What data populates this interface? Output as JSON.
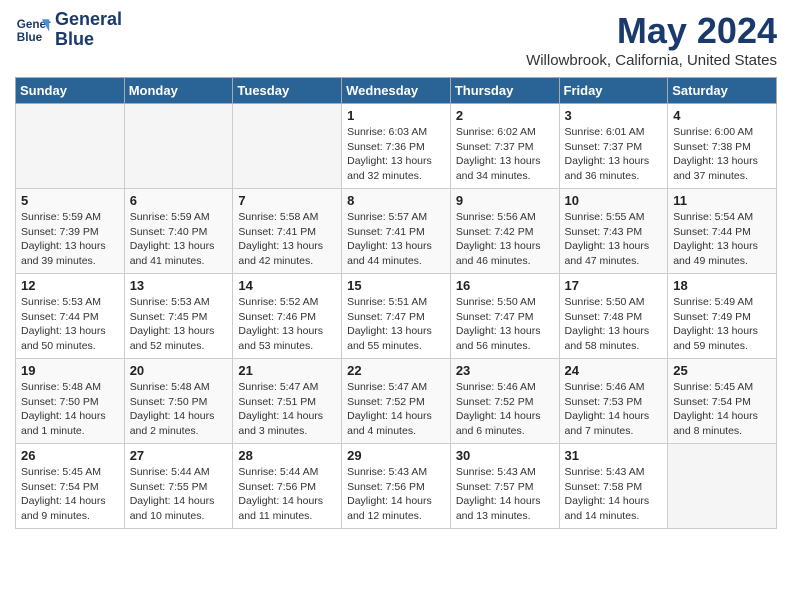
{
  "header": {
    "logo_line1": "General",
    "logo_line2": "Blue",
    "month_title": "May 2024",
    "location": "Willowbrook, California, United States"
  },
  "days_of_week": [
    "Sunday",
    "Monday",
    "Tuesday",
    "Wednesday",
    "Thursday",
    "Friday",
    "Saturday"
  ],
  "weeks": [
    [
      {
        "num": "",
        "empty": true
      },
      {
        "num": "",
        "empty": true
      },
      {
        "num": "",
        "empty": true
      },
      {
        "num": "1",
        "sunrise": "6:03 AM",
        "sunset": "7:36 PM",
        "daylight": "13 hours and 32 minutes."
      },
      {
        "num": "2",
        "sunrise": "6:02 AM",
        "sunset": "7:37 PM",
        "daylight": "13 hours and 34 minutes."
      },
      {
        "num": "3",
        "sunrise": "6:01 AM",
        "sunset": "7:37 PM",
        "daylight": "13 hours and 36 minutes."
      },
      {
        "num": "4",
        "sunrise": "6:00 AM",
        "sunset": "7:38 PM",
        "daylight": "13 hours and 37 minutes."
      }
    ],
    [
      {
        "num": "5",
        "sunrise": "5:59 AM",
        "sunset": "7:39 PM",
        "daylight": "13 hours and 39 minutes."
      },
      {
        "num": "6",
        "sunrise": "5:59 AM",
        "sunset": "7:40 PM",
        "daylight": "13 hours and 41 minutes."
      },
      {
        "num": "7",
        "sunrise": "5:58 AM",
        "sunset": "7:41 PM",
        "daylight": "13 hours and 42 minutes."
      },
      {
        "num": "8",
        "sunrise": "5:57 AM",
        "sunset": "7:41 PM",
        "daylight": "13 hours and 44 minutes."
      },
      {
        "num": "9",
        "sunrise": "5:56 AM",
        "sunset": "7:42 PM",
        "daylight": "13 hours and 46 minutes."
      },
      {
        "num": "10",
        "sunrise": "5:55 AM",
        "sunset": "7:43 PM",
        "daylight": "13 hours and 47 minutes."
      },
      {
        "num": "11",
        "sunrise": "5:54 AM",
        "sunset": "7:44 PM",
        "daylight": "13 hours and 49 minutes."
      }
    ],
    [
      {
        "num": "12",
        "sunrise": "5:53 AM",
        "sunset": "7:44 PM",
        "daylight": "13 hours and 50 minutes."
      },
      {
        "num": "13",
        "sunrise": "5:53 AM",
        "sunset": "7:45 PM",
        "daylight": "13 hours and 52 minutes."
      },
      {
        "num": "14",
        "sunrise": "5:52 AM",
        "sunset": "7:46 PM",
        "daylight": "13 hours and 53 minutes."
      },
      {
        "num": "15",
        "sunrise": "5:51 AM",
        "sunset": "7:47 PM",
        "daylight": "13 hours and 55 minutes."
      },
      {
        "num": "16",
        "sunrise": "5:50 AM",
        "sunset": "7:47 PM",
        "daylight": "13 hours and 56 minutes."
      },
      {
        "num": "17",
        "sunrise": "5:50 AM",
        "sunset": "7:48 PM",
        "daylight": "13 hours and 58 minutes."
      },
      {
        "num": "18",
        "sunrise": "5:49 AM",
        "sunset": "7:49 PM",
        "daylight": "13 hours and 59 minutes."
      }
    ],
    [
      {
        "num": "19",
        "sunrise": "5:48 AM",
        "sunset": "7:50 PM",
        "daylight": "14 hours and 1 minute."
      },
      {
        "num": "20",
        "sunrise": "5:48 AM",
        "sunset": "7:50 PM",
        "daylight": "14 hours and 2 minutes."
      },
      {
        "num": "21",
        "sunrise": "5:47 AM",
        "sunset": "7:51 PM",
        "daylight": "14 hours and 3 minutes."
      },
      {
        "num": "22",
        "sunrise": "5:47 AM",
        "sunset": "7:52 PM",
        "daylight": "14 hours and 4 minutes."
      },
      {
        "num": "23",
        "sunrise": "5:46 AM",
        "sunset": "7:52 PM",
        "daylight": "14 hours and 6 minutes."
      },
      {
        "num": "24",
        "sunrise": "5:46 AM",
        "sunset": "7:53 PM",
        "daylight": "14 hours and 7 minutes."
      },
      {
        "num": "25",
        "sunrise": "5:45 AM",
        "sunset": "7:54 PM",
        "daylight": "14 hours and 8 minutes."
      }
    ],
    [
      {
        "num": "26",
        "sunrise": "5:45 AM",
        "sunset": "7:54 PM",
        "daylight": "14 hours and 9 minutes."
      },
      {
        "num": "27",
        "sunrise": "5:44 AM",
        "sunset": "7:55 PM",
        "daylight": "14 hours and 10 minutes."
      },
      {
        "num": "28",
        "sunrise": "5:44 AM",
        "sunset": "7:56 PM",
        "daylight": "14 hours and 11 minutes."
      },
      {
        "num": "29",
        "sunrise": "5:43 AM",
        "sunset": "7:56 PM",
        "daylight": "14 hours and 12 minutes."
      },
      {
        "num": "30",
        "sunrise": "5:43 AM",
        "sunset": "7:57 PM",
        "daylight": "14 hours and 13 minutes."
      },
      {
        "num": "31",
        "sunrise": "5:43 AM",
        "sunset": "7:58 PM",
        "daylight": "14 hours and 14 minutes."
      },
      {
        "num": "",
        "empty": true
      }
    ]
  ]
}
